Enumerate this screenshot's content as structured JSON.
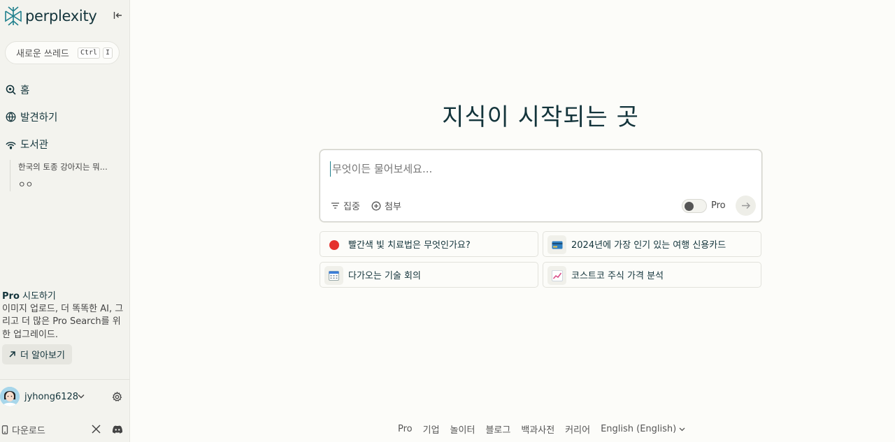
{
  "colors": {
    "accent": "#20808d",
    "text": "#13343b",
    "sidebar_bg": "#f3f3ee",
    "page_bg": "#fcfcf9",
    "red_dot": "#e5322d"
  },
  "sidebar": {
    "logo_text": "perplexity",
    "new_thread": {
      "label": "새로운 쓰레드",
      "kbd_ctrl": "Ctrl",
      "kbd_key": "I"
    },
    "nav": [
      {
        "label": "홈",
        "icon": "search-icon"
      },
      {
        "label": "발견하기",
        "icon": "globe-icon"
      },
      {
        "label": "도서관",
        "icon": "library-icon"
      }
    ],
    "library_items": [
      "한국의 토종 강아지는 뭐...",
      "ㅇㅇ"
    ],
    "pro_promo": {
      "pro_word": "Pro",
      "title_rest": " 시도하기",
      "body": "이미지 업로드, 더 똑똑한 AI, 그리고 더 많은 Pro Search를 위한 업그레이드.",
      "learn_more": "더 알아보기"
    },
    "user": {
      "name": "jyhong6128"
    },
    "download_label": "다운로드"
  },
  "main": {
    "heading": "지식이 시작되는 곳",
    "search": {
      "placeholder": "무엇이든 물어보세요...",
      "focus_label": "집중",
      "attach_label": "첨부",
      "pro_label": "Pro"
    },
    "suggestions": [
      {
        "label": "빨간색 빛 치료법은 무엇인가요?",
        "icon": "red-circle-icon"
      },
      {
        "label": "2024년에 가장 인기 있는 여행 신용카드",
        "icon": "credit-card-icon"
      },
      {
        "label": "다가오는 기술 회의",
        "icon": "calendar-icon"
      },
      {
        "label": "코스트코 주식 가격 분석",
        "icon": "chart-increasing-icon"
      }
    ]
  },
  "footer": {
    "links": [
      "Pro",
      "기업",
      "놀이터",
      "블로그",
      "백과사전",
      "커리어"
    ],
    "language": "English (English)"
  }
}
